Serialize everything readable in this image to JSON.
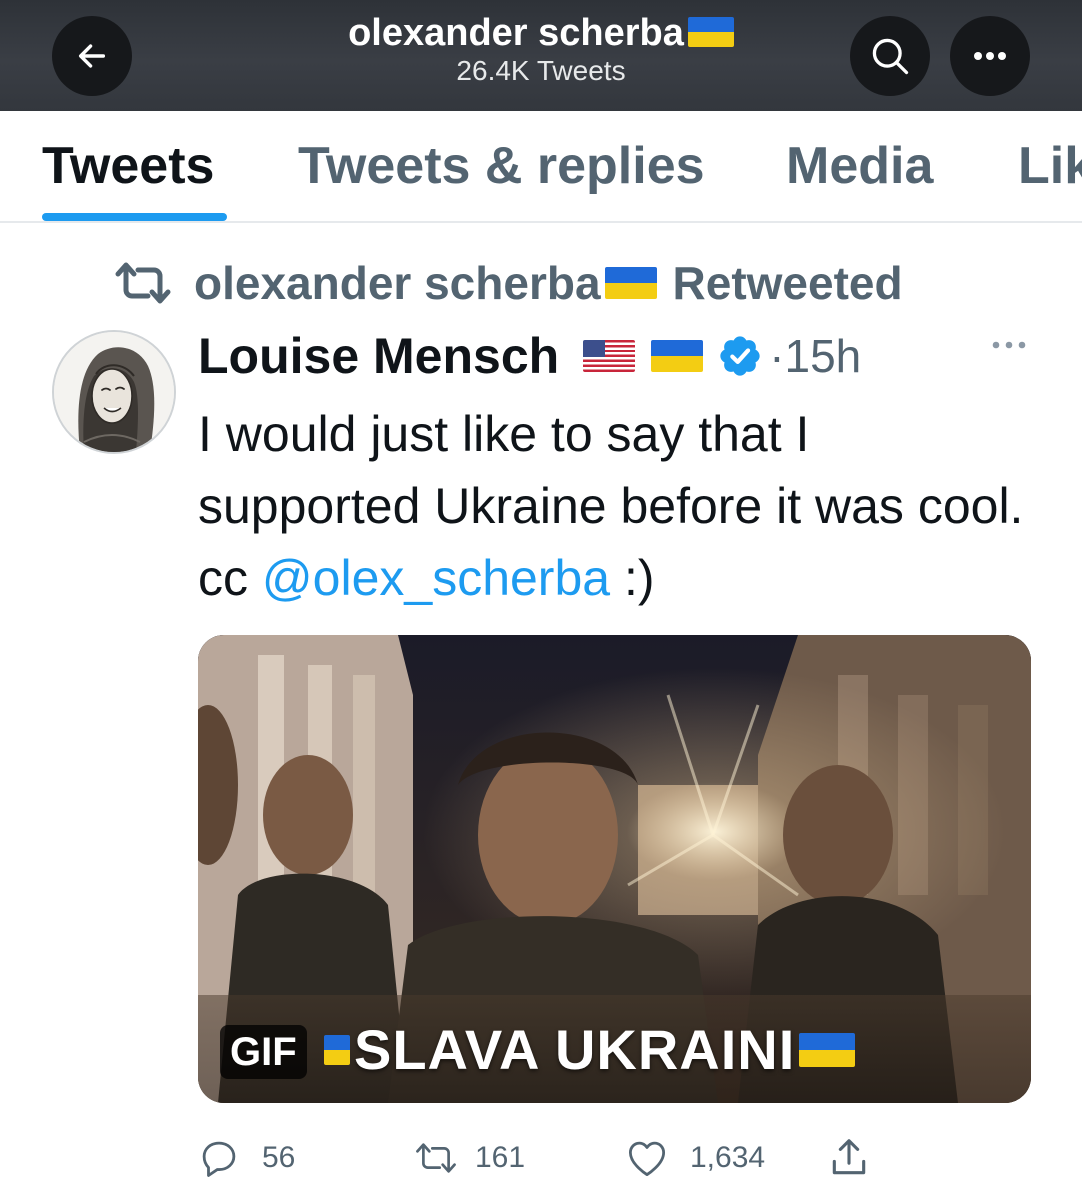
{
  "header": {
    "title": "olexander scherba",
    "subtitle": "26.4K Tweets",
    "back_icon": "arrow-left-icon",
    "search_icon": "search-icon",
    "more_icon": "more-horizontal-icon"
  },
  "tabs": [
    {
      "label": "Tweets",
      "active": true
    },
    {
      "label": "Tweets & replies",
      "active": false
    },
    {
      "label": "Media",
      "active": false
    },
    {
      "label": "Likes",
      "active": false
    }
  ],
  "retweet": {
    "icon": "retweet-icon",
    "by": "olexander scherba",
    "suffix": "Retweeted"
  },
  "tweet": {
    "author": "Louise Mensch",
    "time": "15h",
    "separator": "·",
    "text_before": "I would just like to say that I supported Ukraine before it was cool. cc ",
    "mention": "@olex_scherba",
    "text_after": " :)",
    "media": {
      "badge": "GIF",
      "caption": "SLAVA UKRAINI"
    },
    "stats": {
      "replies": "56",
      "retweets": "161",
      "likes": "1,634"
    }
  },
  "colors": {
    "accent": "#1d9bf0",
    "topbar": "#34383e",
    "muted_text": "#536471",
    "flag_ua_blue": "#1f6ad8",
    "flag_ua_yellow": "#f3cd13"
  }
}
